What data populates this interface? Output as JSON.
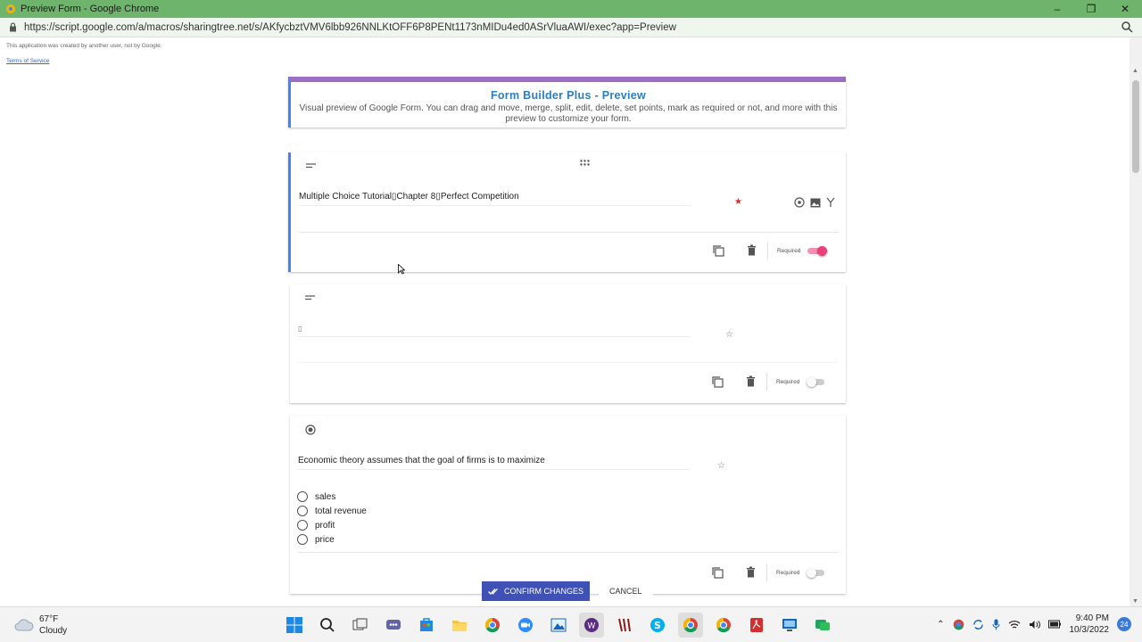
{
  "window": {
    "title": "Preview Form - Google Chrome",
    "controls": {
      "minimize": "–",
      "restore": "❐",
      "close": "✕"
    }
  },
  "address_bar": {
    "url": "https://script.google.com/a/macros/sharingtree.net/s/AKfycbztVMV6lbb926NNLKtOFF6P8PENt1173nMIDu4ed0ASrVluaAWI/exec?app=Preview"
  },
  "page": {
    "notice": "This application was created by another user, not by Google.",
    "terms_link": "Terms of Service",
    "header": {
      "title": "Form Builder Plus - Preview",
      "description": "Visual preview of Google Form. You can drag and move, merge, split, edit, delete, set points, mark as required or not, and more with this preview to customize your form."
    },
    "cards": [
      {
        "question": "Multiple Choice Tutorial▯Chapter 8▯Perfect Competition",
        "required_label": "Required",
        "required": true
      },
      {
        "question": "▯",
        "required_label": "Required",
        "required": false
      },
      {
        "question": "Economic theory assumes that the goal of firms is to maximize",
        "options": [
          "sales",
          "total revenue",
          "profit",
          "price"
        ],
        "required_label": "Required",
        "required": false
      }
    ],
    "actions": {
      "confirm": "CONFIRM CHANGES",
      "cancel": "CANCEL"
    }
  },
  "taskbar": {
    "weather_temp": "67°F",
    "weather_desc": "Cloudy",
    "time": "9:40 PM",
    "date": "10/3/2022",
    "notification_count": "24"
  },
  "colors": {
    "title_bar": "#6fb46c",
    "header_accent": "#9b6fc4",
    "active_border": "#4285f4",
    "toggle_on": "#ec407a",
    "confirm_button": "#3f51b5"
  }
}
